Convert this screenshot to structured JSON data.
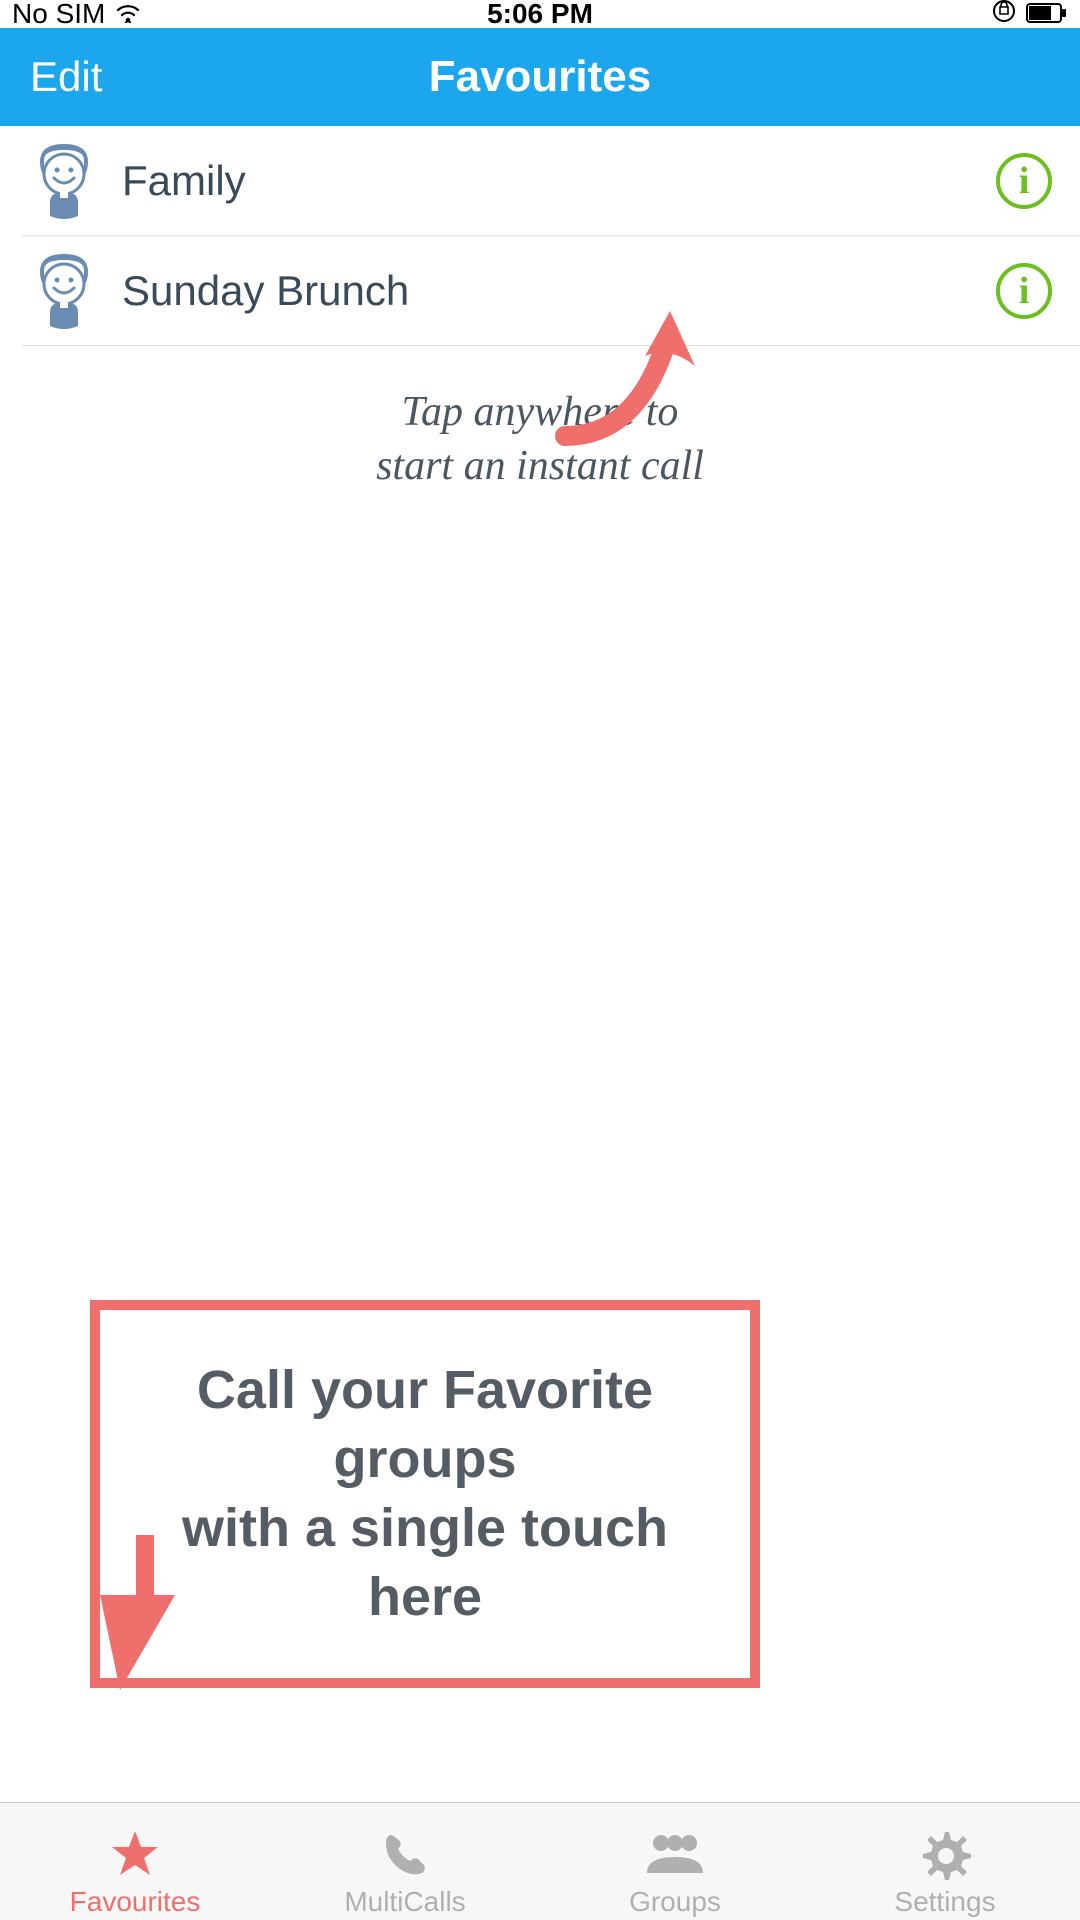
{
  "statusbar": {
    "carrier": "No SIM",
    "time": "5:06 PM"
  },
  "navbar": {
    "edit": "Edit",
    "title": "Favourites"
  },
  "favourites": [
    {
      "name": "Family"
    },
    {
      "name": "Sunday Brunch"
    }
  ],
  "hint": {
    "line1": "Tap anywhere to",
    "line2": "start an instant call"
  },
  "callout": {
    "line1": "Call your Favorite groups",
    "line2": "with a single touch here"
  },
  "tabs": [
    {
      "label": "Favourites",
      "active": true
    },
    {
      "label": "MultiCalls",
      "active": false
    },
    {
      "label": "Groups",
      "active": false
    },
    {
      "label": "Settings",
      "active": false
    }
  ],
  "colors": {
    "accent": "#1CA6EE",
    "callout": "#EF6F6C",
    "info": "#6CBF1F"
  }
}
